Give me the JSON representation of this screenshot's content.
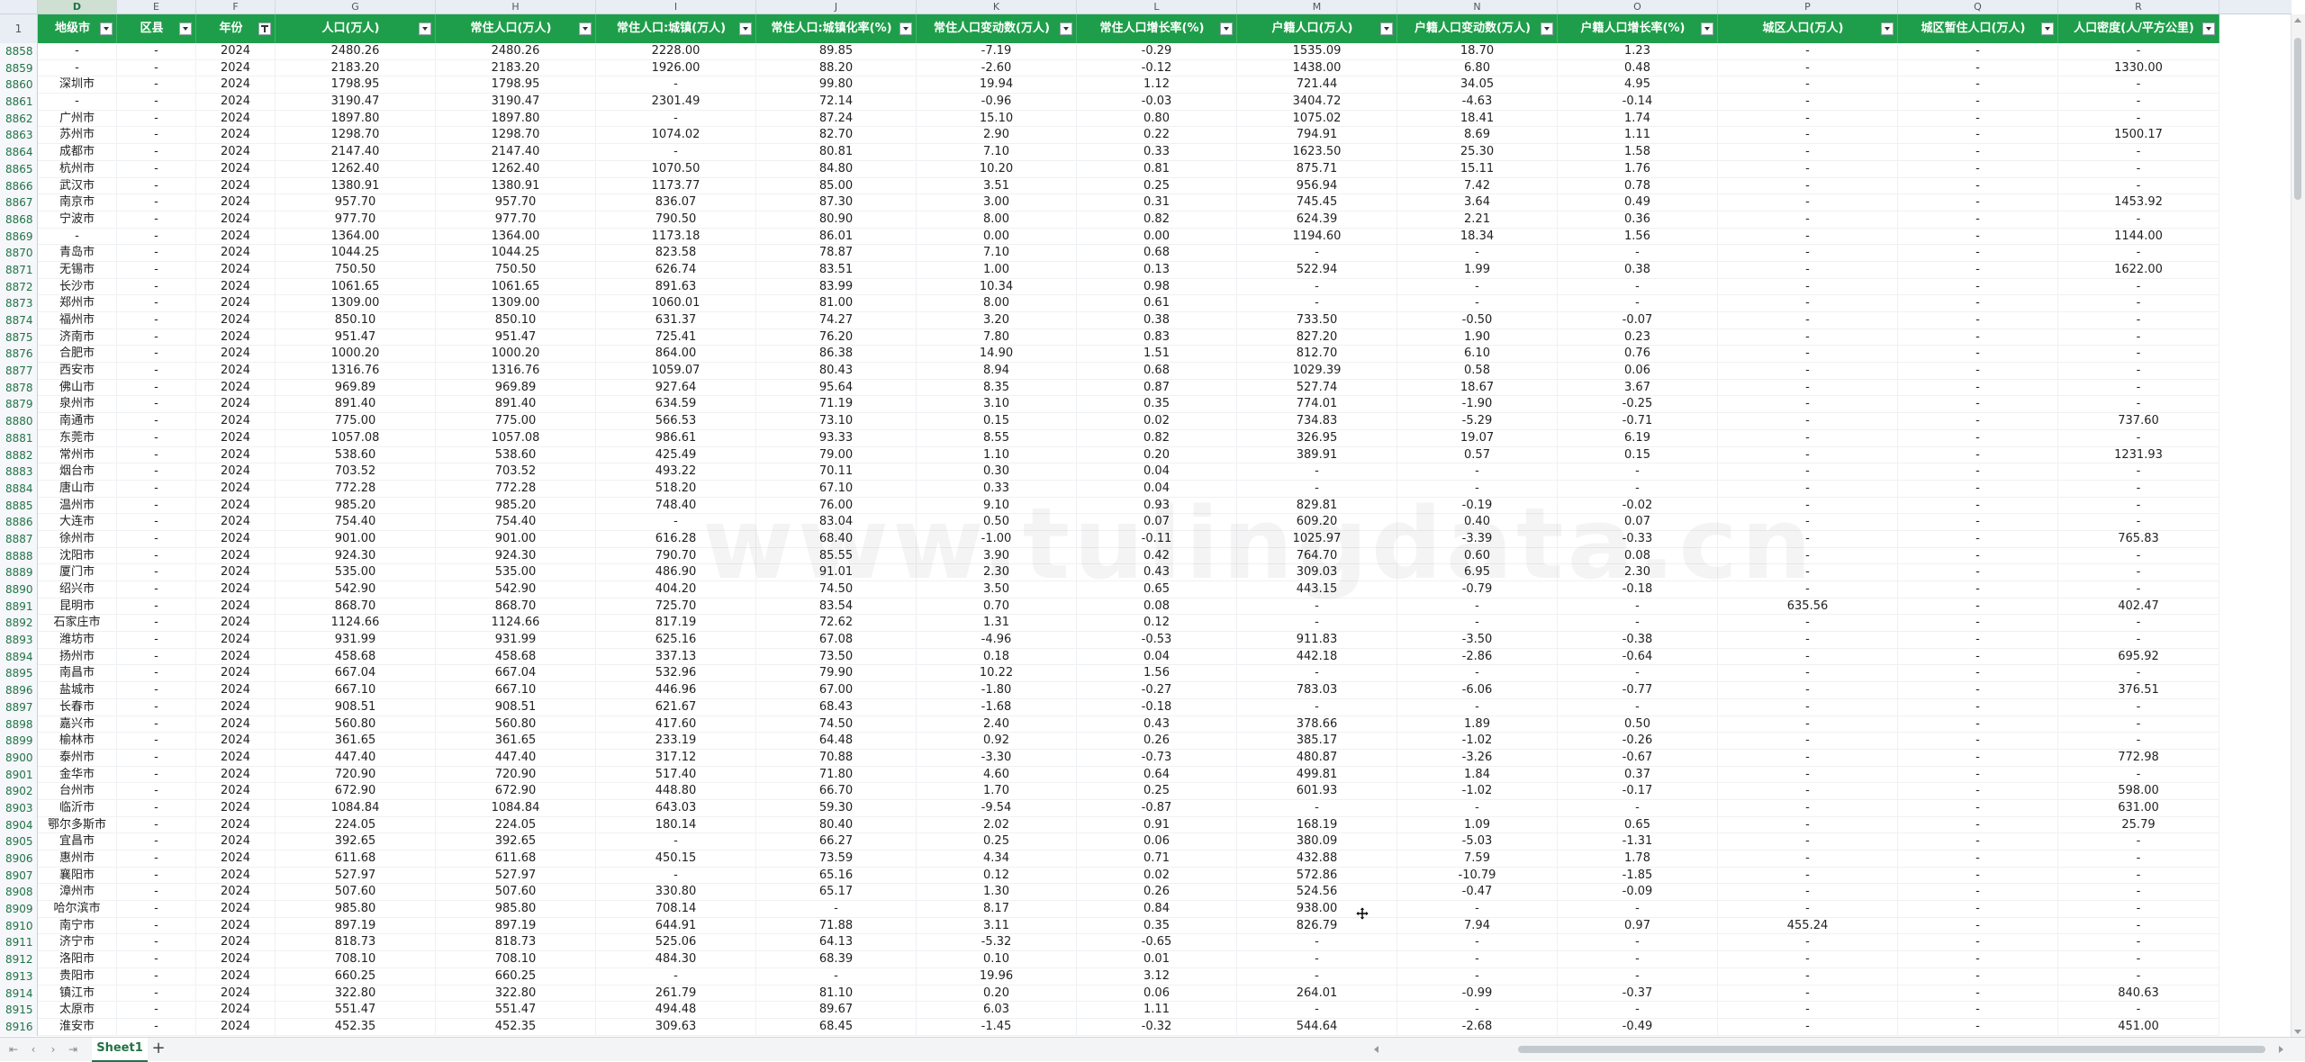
{
  "app": {
    "name": "spreadsheet"
  },
  "columns": {
    "row_header": "1",
    "letters": [
      "D",
      "E",
      "F",
      "G",
      "H",
      "I",
      "J",
      "K",
      "L",
      "M",
      "N",
      "O",
      "P",
      "Q",
      "R"
    ],
    "selected_letter": "D",
    "headers": [
      "地级市",
      "区县",
      "年份",
      "人口(万人)",
      "常住人口(万人)",
      "常住人口:城镇(万人)",
      "常住人口:城镇化率(%)",
      "常住人口变动数(万人)",
      "常住人口增长率(%)",
      "户籍人口(万人)",
      "户籍人口变动数(万人)",
      "户籍人口增长率(%)",
      "城区人口(万人)",
      "城区暂住人口(万人)",
      "人口密度(人/平方公里)"
    ],
    "active_filter_column": "年份"
  },
  "rows": [
    {
      "n": "8858",
      "c": [
        "-",
        "-",
        "2024",
        "2480.26",
        "2480.26",
        "2228.00",
        "89.85",
        "-7.19",
        "-0.29",
        "1535.09",
        "18.70",
        "1.23",
        "-",
        "-",
        "-"
      ]
    },
    {
      "n": "8859",
      "c": [
        "-",
        "-",
        "2024",
        "2183.20",
        "2183.20",
        "1926.00",
        "88.20",
        "-2.60",
        "-0.12",
        "1438.00",
        "6.80",
        "0.48",
        "-",
        "-",
        "1330.00"
      ]
    },
    {
      "n": "8860",
      "c": [
        "深圳市",
        "-",
        "2024",
        "1798.95",
        "1798.95",
        "-",
        "99.80",
        "19.94",
        "1.12",
        "721.44",
        "34.05",
        "4.95",
        "-",
        "-",
        "-"
      ]
    },
    {
      "n": "8861",
      "c": [
        "-",
        "-",
        "2024",
        "3190.47",
        "3190.47",
        "2301.49",
        "72.14",
        "-0.96",
        "-0.03",
        "3404.72",
        "-4.63",
        "-0.14",
        "-",
        "-",
        "-"
      ]
    },
    {
      "n": "8862",
      "c": [
        "广州市",
        "-",
        "2024",
        "1897.80",
        "1897.80",
        "-",
        "87.24",
        "15.10",
        "0.80",
        "1075.02",
        "18.41",
        "1.74",
        "-",
        "-",
        "-"
      ]
    },
    {
      "n": "8863",
      "c": [
        "苏州市",
        "-",
        "2024",
        "1298.70",
        "1298.70",
        "1074.02",
        "82.70",
        "2.90",
        "0.22",
        "794.91",
        "8.69",
        "1.11",
        "-",
        "-",
        "1500.17"
      ]
    },
    {
      "n": "8864",
      "c": [
        "成都市",
        "-",
        "2024",
        "2147.40",
        "2147.40",
        "-",
        "80.81",
        "7.10",
        "0.33",
        "1623.50",
        "25.30",
        "1.58",
        "-",
        "-",
        "-"
      ]
    },
    {
      "n": "8865",
      "c": [
        "杭州市",
        "-",
        "2024",
        "1262.40",
        "1262.40",
        "1070.50",
        "84.80",
        "10.20",
        "0.81",
        "875.71",
        "15.11",
        "1.76",
        "-",
        "-",
        "-"
      ]
    },
    {
      "n": "8866",
      "c": [
        "武汉市",
        "-",
        "2024",
        "1380.91",
        "1380.91",
        "1173.77",
        "85.00",
        "3.51",
        "0.25",
        "956.94",
        "7.42",
        "0.78",
        "-",
        "-",
        "-"
      ]
    },
    {
      "n": "8867",
      "c": [
        "南京市",
        "-",
        "2024",
        "957.70",
        "957.70",
        "836.07",
        "87.30",
        "3.00",
        "0.31",
        "745.45",
        "3.64",
        "0.49",
        "-",
        "-",
        "1453.92"
      ]
    },
    {
      "n": "8868",
      "c": [
        "宁波市",
        "-",
        "2024",
        "977.70",
        "977.70",
        "790.50",
        "80.90",
        "8.00",
        "0.82",
        "624.39",
        "2.21",
        "0.36",
        "-",
        "-",
        "-"
      ]
    },
    {
      "n": "8869",
      "c": [
        "-",
        "-",
        "2024",
        "1364.00",
        "1364.00",
        "1173.18",
        "86.01",
        "0.00",
        "0.00",
        "1194.60",
        "18.34",
        "1.56",
        "-",
        "-",
        "1144.00"
      ]
    },
    {
      "n": "8870",
      "c": [
        "青岛市",
        "-",
        "2024",
        "1044.25",
        "1044.25",
        "823.58",
        "78.87",
        "7.10",
        "0.68",
        "-",
        "-",
        "-",
        "-",
        "-",
        "-"
      ]
    },
    {
      "n": "8871",
      "c": [
        "无锡市",
        "-",
        "2024",
        "750.50",
        "750.50",
        "626.74",
        "83.51",
        "1.00",
        "0.13",
        "522.94",
        "1.99",
        "0.38",
        "-",
        "-",
        "1622.00"
      ]
    },
    {
      "n": "8872",
      "c": [
        "长沙市",
        "-",
        "2024",
        "1061.65",
        "1061.65",
        "891.63",
        "83.99",
        "10.34",
        "0.98",
        "-",
        "-",
        "-",
        "-",
        "-",
        "-"
      ]
    },
    {
      "n": "8873",
      "c": [
        "郑州市",
        "-",
        "2024",
        "1309.00",
        "1309.00",
        "1060.01",
        "81.00",
        "8.00",
        "0.61",
        "-",
        "-",
        "-",
        "-",
        "-",
        "-"
      ]
    },
    {
      "n": "8874",
      "c": [
        "福州市",
        "-",
        "2024",
        "850.10",
        "850.10",
        "631.37",
        "74.27",
        "3.20",
        "0.38",
        "733.50",
        "-0.50",
        "-0.07",
        "-",
        "-",
        "-"
      ]
    },
    {
      "n": "8875",
      "c": [
        "济南市",
        "-",
        "2024",
        "951.47",
        "951.47",
        "725.41",
        "76.20",
        "7.80",
        "0.83",
        "827.20",
        "1.90",
        "0.23",
        "-",
        "-",
        "-"
      ]
    },
    {
      "n": "8876",
      "c": [
        "合肥市",
        "-",
        "2024",
        "1000.20",
        "1000.20",
        "864.00",
        "86.38",
        "14.90",
        "1.51",
        "812.70",
        "6.10",
        "0.76",
        "-",
        "-",
        "-"
      ]
    },
    {
      "n": "8877",
      "c": [
        "西安市",
        "-",
        "2024",
        "1316.76",
        "1316.76",
        "1059.07",
        "80.43",
        "8.94",
        "0.68",
        "1029.39",
        "0.58",
        "0.06",
        "-",
        "-",
        "-"
      ]
    },
    {
      "n": "8878",
      "c": [
        "佛山市",
        "-",
        "2024",
        "969.89",
        "969.89",
        "927.64",
        "95.64",
        "8.35",
        "0.87",
        "527.74",
        "18.67",
        "3.67",
        "-",
        "-",
        "-"
      ]
    },
    {
      "n": "8879",
      "c": [
        "泉州市",
        "-",
        "2024",
        "891.40",
        "891.40",
        "634.59",
        "71.19",
        "3.10",
        "0.35",
        "774.01",
        "-1.90",
        "-0.25",
        "-",
        "-",
        "-"
      ]
    },
    {
      "n": "8880",
      "c": [
        "南通市",
        "-",
        "2024",
        "775.00",
        "775.00",
        "566.53",
        "73.10",
        "0.15",
        "0.02",
        "734.83",
        "-5.29",
        "-0.71",
        "-",
        "-",
        "737.60"
      ]
    },
    {
      "n": "8881",
      "c": [
        "东莞市",
        "-",
        "2024",
        "1057.08",
        "1057.08",
        "986.61",
        "93.33",
        "8.55",
        "0.82",
        "326.95",
        "19.07",
        "6.19",
        "-",
        "-",
        "-"
      ]
    },
    {
      "n": "8882",
      "c": [
        "常州市",
        "-",
        "2024",
        "538.60",
        "538.60",
        "425.49",
        "79.00",
        "1.10",
        "0.20",
        "389.91",
        "0.57",
        "0.15",
        "-",
        "-",
        "1231.93"
      ]
    },
    {
      "n": "8883",
      "c": [
        "烟台市",
        "-",
        "2024",
        "703.52",
        "703.52",
        "493.22",
        "70.11",
        "0.30",
        "0.04",
        "-",
        "-",
        "-",
        "-",
        "-",
        "-"
      ]
    },
    {
      "n": "8884",
      "c": [
        "唐山市",
        "-",
        "2024",
        "772.28",
        "772.28",
        "518.20",
        "67.10",
        "0.33",
        "0.04",
        "-",
        "-",
        "-",
        "-",
        "-",
        "-"
      ]
    },
    {
      "n": "8885",
      "c": [
        "温州市",
        "-",
        "2024",
        "985.20",
        "985.20",
        "748.40",
        "76.00",
        "9.10",
        "0.93",
        "829.81",
        "-0.19",
        "-0.02",
        "-",
        "-",
        "-"
      ]
    },
    {
      "n": "8886",
      "c": [
        "大连市",
        "-",
        "2024",
        "754.40",
        "754.40",
        "-",
        "83.04",
        "0.50",
        "0.07",
        "609.20",
        "0.40",
        "0.07",
        "-",
        "-",
        "-"
      ]
    },
    {
      "n": "8887",
      "c": [
        "徐州市",
        "-",
        "2024",
        "901.00",
        "901.00",
        "616.28",
        "68.40",
        "-1.00",
        "-0.11",
        "1025.97",
        "-3.39",
        "-0.33",
        "-",
        "-",
        "765.83"
      ]
    },
    {
      "n": "8888",
      "c": [
        "沈阳市",
        "-",
        "2024",
        "924.30",
        "924.30",
        "790.70",
        "85.55",
        "3.90",
        "0.42",
        "764.70",
        "0.60",
        "0.08",
        "-",
        "-",
        "-"
      ]
    },
    {
      "n": "8889",
      "c": [
        "厦门市",
        "-",
        "2024",
        "535.00",
        "535.00",
        "486.90",
        "91.01",
        "2.30",
        "0.43",
        "309.03",
        "6.95",
        "2.30",
        "-",
        "-",
        "-"
      ]
    },
    {
      "n": "8890",
      "c": [
        "绍兴市",
        "-",
        "2024",
        "542.90",
        "542.90",
        "404.20",
        "74.50",
        "3.50",
        "0.65",
        "443.15",
        "-0.79",
        "-0.18",
        "-",
        "-",
        "-"
      ]
    },
    {
      "n": "8891",
      "c": [
        "昆明市",
        "-",
        "2024",
        "868.70",
        "868.70",
        "725.70",
        "83.54",
        "0.70",
        "0.08",
        "-",
        "-",
        "-",
        "635.56",
        "-",
        "402.47"
      ]
    },
    {
      "n": "8892",
      "c": [
        "石家庄市",
        "-",
        "2024",
        "1124.66",
        "1124.66",
        "817.19",
        "72.62",
        "1.31",
        "0.12",
        "-",
        "-",
        "-",
        "-",
        "-",
        "-"
      ]
    },
    {
      "n": "8893",
      "c": [
        "潍坊市",
        "-",
        "2024",
        "931.99",
        "931.99",
        "625.16",
        "67.08",
        "-4.96",
        "-0.53",
        "911.83",
        "-3.50",
        "-0.38",
        "-",
        "-",
        "-"
      ]
    },
    {
      "n": "8894",
      "c": [
        "扬州市",
        "-",
        "2024",
        "458.68",
        "458.68",
        "337.13",
        "73.50",
        "0.18",
        "0.04",
        "442.18",
        "-2.86",
        "-0.64",
        "-",
        "-",
        "695.92"
      ]
    },
    {
      "n": "8895",
      "c": [
        "南昌市",
        "-",
        "2024",
        "667.04",
        "667.04",
        "532.96",
        "79.90",
        "10.22",
        "1.56",
        "-",
        "-",
        "-",
        "-",
        "-",
        "-"
      ]
    },
    {
      "n": "8896",
      "c": [
        "盐城市",
        "-",
        "2024",
        "667.10",
        "667.10",
        "446.96",
        "67.00",
        "-1.80",
        "-0.27",
        "783.03",
        "-6.06",
        "-0.77",
        "-",
        "-",
        "376.51"
      ]
    },
    {
      "n": "8897",
      "c": [
        "长春市",
        "-",
        "2024",
        "908.51",
        "908.51",
        "621.67",
        "68.43",
        "-1.68",
        "-0.18",
        "-",
        "-",
        "-",
        "-",
        "-",
        "-"
      ]
    },
    {
      "n": "8898",
      "c": [
        "嘉兴市",
        "-",
        "2024",
        "560.80",
        "560.80",
        "417.60",
        "74.50",
        "2.40",
        "0.43",
        "378.66",
        "1.89",
        "0.50",
        "-",
        "-",
        "-"
      ]
    },
    {
      "n": "8899",
      "c": [
        "榆林市",
        "-",
        "2024",
        "361.65",
        "361.65",
        "233.19",
        "64.48",
        "0.92",
        "0.26",
        "385.17",
        "-1.02",
        "-0.26",
        "-",
        "-",
        "-"
      ]
    },
    {
      "n": "8900",
      "c": [
        "泰州市",
        "-",
        "2024",
        "447.40",
        "447.40",
        "317.12",
        "70.88",
        "-3.30",
        "-0.73",
        "480.87",
        "-3.26",
        "-0.67",
        "-",
        "-",
        "772.98"
      ]
    },
    {
      "n": "8901",
      "c": [
        "金华市",
        "-",
        "2024",
        "720.90",
        "720.90",
        "517.40",
        "71.80",
        "4.60",
        "0.64",
        "499.81",
        "1.84",
        "0.37",
        "-",
        "-",
        "-"
      ]
    },
    {
      "n": "8902",
      "c": [
        "台州市",
        "-",
        "2024",
        "672.90",
        "672.90",
        "448.80",
        "66.70",
        "1.70",
        "0.25",
        "601.93",
        "-1.02",
        "-0.17",
        "-",
        "-",
        "598.00"
      ]
    },
    {
      "n": "8903",
      "c": [
        "临沂市",
        "-",
        "2024",
        "1084.84",
        "1084.84",
        "643.03",
        "59.30",
        "-9.54",
        "-0.87",
        "-",
        "-",
        "-",
        "-",
        "-",
        "631.00"
      ]
    },
    {
      "n": "8904",
      "c": [
        "鄂尔多斯市",
        "-",
        "2024",
        "224.05",
        "224.05",
        "180.14",
        "80.40",
        "2.02",
        "0.91",
        "168.19",
        "1.09",
        "0.65",
        "-",
        "-",
        "25.79"
      ]
    },
    {
      "n": "8905",
      "c": [
        "宜昌市",
        "-",
        "2024",
        "392.65",
        "392.65",
        "-",
        "66.27",
        "0.25",
        "0.06",
        "380.09",
        "-5.03",
        "-1.31",
        "-",
        "-",
        "-"
      ]
    },
    {
      "n": "8906",
      "c": [
        "惠州市",
        "-",
        "2024",
        "611.68",
        "611.68",
        "450.15",
        "73.59",
        "4.34",
        "0.71",
        "432.88",
        "7.59",
        "1.78",
        "-",
        "-",
        "-"
      ]
    },
    {
      "n": "8907",
      "c": [
        "襄阳市",
        "-",
        "2024",
        "527.97",
        "527.97",
        "-",
        "65.16",
        "0.12",
        "0.02",
        "572.86",
        "-10.79",
        "-1.85",
        "-",
        "-",
        "-"
      ]
    },
    {
      "n": "8908",
      "c": [
        "漳州市",
        "-",
        "2024",
        "507.60",
        "507.60",
        "330.80",
        "65.17",
        "1.30",
        "0.26",
        "524.56",
        "-0.47",
        "-0.09",
        "-",
        "-",
        "-"
      ]
    },
    {
      "n": "8909",
      "c": [
        "哈尔滨市",
        "-",
        "2024",
        "985.80",
        "985.80",
        "708.14",
        "-",
        "8.17",
        "0.84",
        "938.00",
        "-",
        "-",
        "-",
        "-",
        "-"
      ]
    },
    {
      "n": "8910",
      "c": [
        "南宁市",
        "-",
        "2024",
        "897.19",
        "897.19",
        "644.91",
        "71.88",
        "3.11",
        "0.35",
        "826.79",
        "7.94",
        "0.97",
        "455.24",
        "-",
        "-"
      ]
    },
    {
      "n": "8911",
      "c": [
        "济宁市",
        "-",
        "2024",
        "818.73",
        "818.73",
        "525.06",
        "64.13",
        "-5.32",
        "-0.65",
        "-",
        "-",
        "-",
        "-",
        "-",
        "-"
      ]
    },
    {
      "n": "8912",
      "c": [
        "洛阳市",
        "-",
        "2024",
        "708.10",
        "708.10",
        "484.30",
        "68.39",
        "0.10",
        "0.01",
        "-",
        "-",
        "-",
        "-",
        "-",
        "-"
      ]
    },
    {
      "n": "8913",
      "c": [
        "贵阳市",
        "-",
        "2024",
        "660.25",
        "660.25",
        "-",
        "-",
        "19.96",
        "3.12",
        "-",
        "-",
        "-",
        "-",
        "-",
        "-"
      ]
    },
    {
      "n": "8914",
      "c": [
        "镇江市",
        "-",
        "2024",
        "322.80",
        "322.80",
        "261.79",
        "81.10",
        "0.20",
        "0.06",
        "264.01",
        "-0.99",
        "-0.37",
        "-",
        "-",
        "840.63"
      ]
    },
    {
      "n": "8915",
      "c": [
        "太原市",
        "-",
        "2024",
        "551.47",
        "551.47",
        "494.48",
        "89.67",
        "6.03",
        "1.11",
        "-",
        "-",
        "-",
        "-",
        "-",
        "-"
      ]
    },
    {
      "n": "8916",
      "c": [
        "淮安市",
        "-",
        "2024",
        "452.35",
        "452.35",
        "309.63",
        "68.45",
        "-1.45",
        "-0.32",
        "544.64",
        "-2.68",
        "-0.49",
        "-",
        "-",
        "451.00"
      ]
    }
  ],
  "watermark": "www.tulingdata.cn",
  "tabs": {
    "sheet_label": "Sheet1",
    "add_label": "+",
    "nav": [
      "⇤",
      "‹",
      "›",
      "⇥"
    ]
  },
  "colors": {
    "header_green": "#1e9e4a",
    "accent": "#217346"
  }
}
